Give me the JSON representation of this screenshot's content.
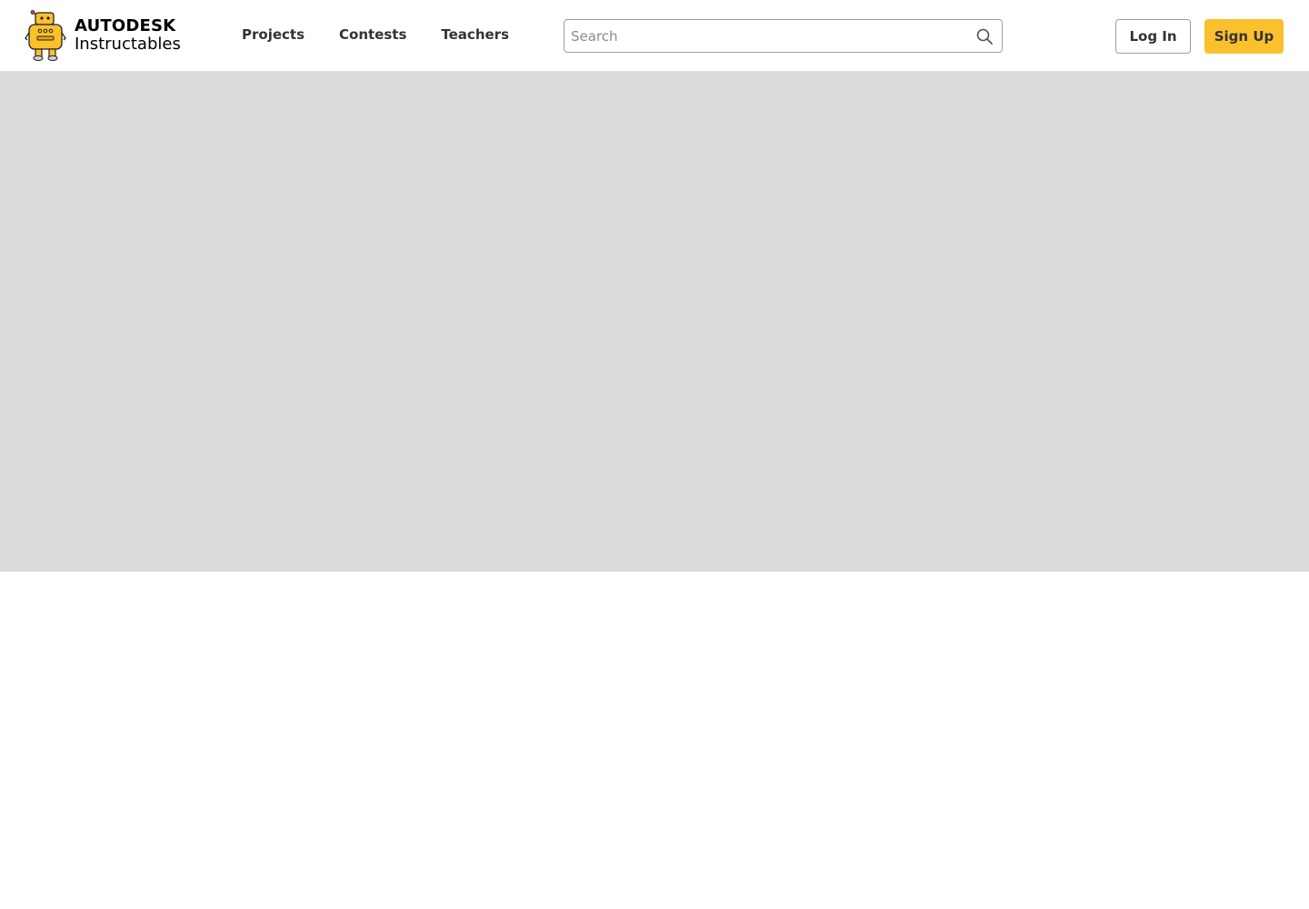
{
  "header": {
    "logo": {
      "brand": "AUTODESK",
      "product": "Instructables",
      "icon": "instructables-robot-icon"
    },
    "nav": [
      {
        "label": "Projects"
      },
      {
        "label": "Contests"
      },
      {
        "label": "Teachers"
      }
    ],
    "search": {
      "placeholder": "Search",
      "value": "",
      "icon": "search-icon"
    },
    "login_label": "Log In",
    "signup_label": "Sign Up"
  },
  "colors": {
    "accent": "#fac12c",
    "hero_placeholder": "#dcdcdc",
    "text": "#333333"
  }
}
